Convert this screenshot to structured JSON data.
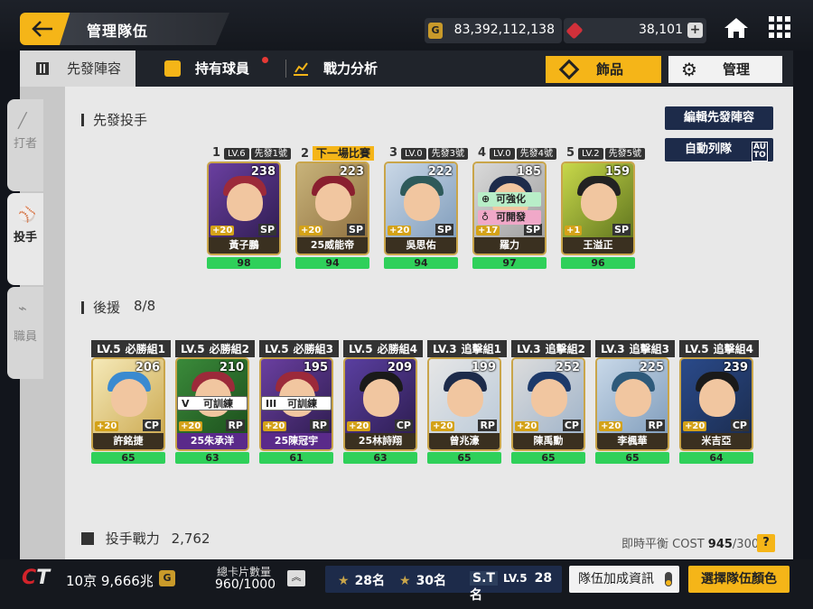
{
  "header": {
    "title": "管理隊伍",
    "gold": "83,392,112,138",
    "gems": "38,101",
    "gold_icon_label": "G"
  },
  "tabs": {
    "lineup": "先發陣容",
    "owned": "持有球員",
    "power": "戰力分析",
    "jewel": "飾品",
    "manage": "管理"
  },
  "sidebar": {
    "batter": "打者",
    "pitcher": "投手",
    "staff": "職員"
  },
  "starters": {
    "title": "先發投手",
    "edit_button": "編輯先發陣容",
    "auto_button": "自動列隊",
    "auto_badge": "AU TO",
    "slots": [
      {
        "num": "1",
        "lv": "LV.6",
        "role": "先發1號",
        "ovr": "238",
        "name": "黃子鵬",
        "power": "98",
        "pos": "SP",
        "plus": "+20"
      },
      {
        "num": "2",
        "lv": "",
        "role": "下一場比賽",
        "ovr": "223",
        "name": "25威能帝",
        "power": "94",
        "pos": "SP",
        "plus": "+20"
      },
      {
        "num": "3",
        "lv": "LV.0",
        "role": "先發3號",
        "ovr": "222",
        "name": "吳思佑",
        "power": "94",
        "pos": "SP",
        "plus": "+20"
      },
      {
        "num": "4",
        "lv": "LV.0",
        "role": "先發4號",
        "ovr": "185",
        "name": "羅力",
        "power": "97",
        "pos": "SP",
        "plus": "+17"
      },
      {
        "num": "5",
        "lv": "LV.2",
        "role": "先發5號",
        "ovr": "159",
        "name": "王溢正",
        "power": "96",
        "pos": "SP",
        "plus": "+1"
      }
    ],
    "tag_strengthen": "可強化",
    "tag_develop": "可開發"
  },
  "relief": {
    "title": "後援",
    "count": "8/8",
    "slots": [
      {
        "lv": "LV.5",
        "role": "必勝組1",
        "ovr": "206",
        "name": "許銘捷",
        "power": "65",
        "pos": "CP",
        "plus": "+20"
      },
      {
        "lv": "LV.5",
        "role": "必勝組2",
        "ovr": "210",
        "name": "25朱承洋",
        "power": "63",
        "pos": "RP",
        "plus": "+20"
      },
      {
        "lv": "LV.5",
        "role": "必勝組3",
        "ovr": "195",
        "name": "25陳冠宇",
        "power": "61",
        "pos": "RP",
        "plus": "+20"
      },
      {
        "lv": "LV.5",
        "role": "必勝組4",
        "ovr": "209",
        "name": "25林詩翔",
        "power": "63",
        "pos": "CP",
        "plus": "+20"
      },
      {
        "lv": "LV.3",
        "role": "追擊組1",
        "ovr": "199",
        "name": "曾兆濠",
        "power": "65",
        "pos": "RP",
        "plus": "+20"
      },
      {
        "lv": "LV.3",
        "role": "追擊組2",
        "ovr": "252",
        "name": "陳禹勳",
        "power": "65",
        "pos": "CP",
        "plus": "+20"
      },
      {
        "lv": "LV.3",
        "role": "追擊組3",
        "ovr": "225",
        "name": "李楓華",
        "power": "65",
        "pos": "RP",
        "plus": "+20"
      },
      {
        "lv": "LV.5",
        "role": "追擊組4",
        "ovr": "239",
        "name": "米吉亞",
        "power": "64",
        "pos": "CP",
        "plus": "+20"
      }
    ],
    "train_tags": [
      {
        "roman": "V",
        "label": "可訓練"
      },
      {
        "roman": "III",
        "label": "可訓練"
      }
    ]
  },
  "footer": {
    "pitch_power_label": "投手戰力",
    "pitch_power_value": "2,762",
    "balance_label": "即時平衡 COST",
    "balance_current": "945",
    "balance_max": "/300",
    "help": "?"
  },
  "bottom": {
    "team_value": "10京 9,666兆",
    "team_value_badge": "G",
    "card_count_label": "總卡片數量",
    "card_count_value": "960/1000",
    "rank1": "28名",
    "rank2": "30名",
    "st_label": "S.T",
    "st_lv": "LV.5",
    "rank3": "28名",
    "bonus_button": "隊伍加成資訊",
    "color_button": "選擇隊伍顏色"
  },
  "colors": {
    "accent": "#f5b518",
    "navy": "#1d2b4a",
    "power_green": "#2fd05a"
  }
}
